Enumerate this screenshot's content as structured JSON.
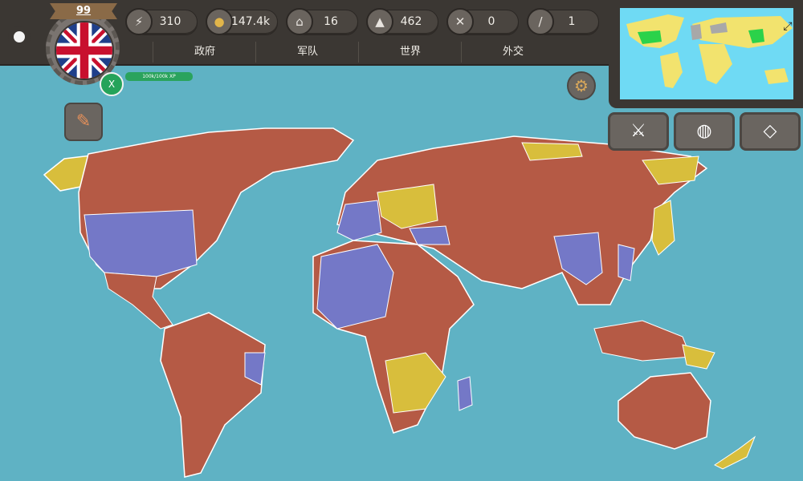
{
  "profile": {
    "level": "99",
    "xp_text": "100k/100k XP",
    "x_label": "X",
    "flag": "united-kingdom-flag"
  },
  "resources": [
    {
      "icon": "energy-icon",
      "value": "310"
    },
    {
      "icon": "gold-icon",
      "value": "147.4k"
    },
    {
      "icon": "population-icon",
      "value": "16"
    },
    {
      "icon": "territory-icon",
      "value": "462"
    },
    {
      "icon": "battles-icon",
      "value": "0"
    },
    {
      "icon": "sword-icon",
      "value": "1"
    }
  ],
  "tabs": [
    "政府",
    "军队",
    "世界",
    "外交"
  ],
  "colors": {
    "ocean": "#5fb2c4",
    "player": "#b55a45",
    "ally": "#7478c7",
    "other": "#d8be3c"
  },
  "minimap": {
    "expand_icon": "expand-icon"
  },
  "actions": [
    {
      "icon": "sword-icon"
    },
    {
      "icon": "globe-icon"
    },
    {
      "icon": "diamond-icon"
    }
  ]
}
